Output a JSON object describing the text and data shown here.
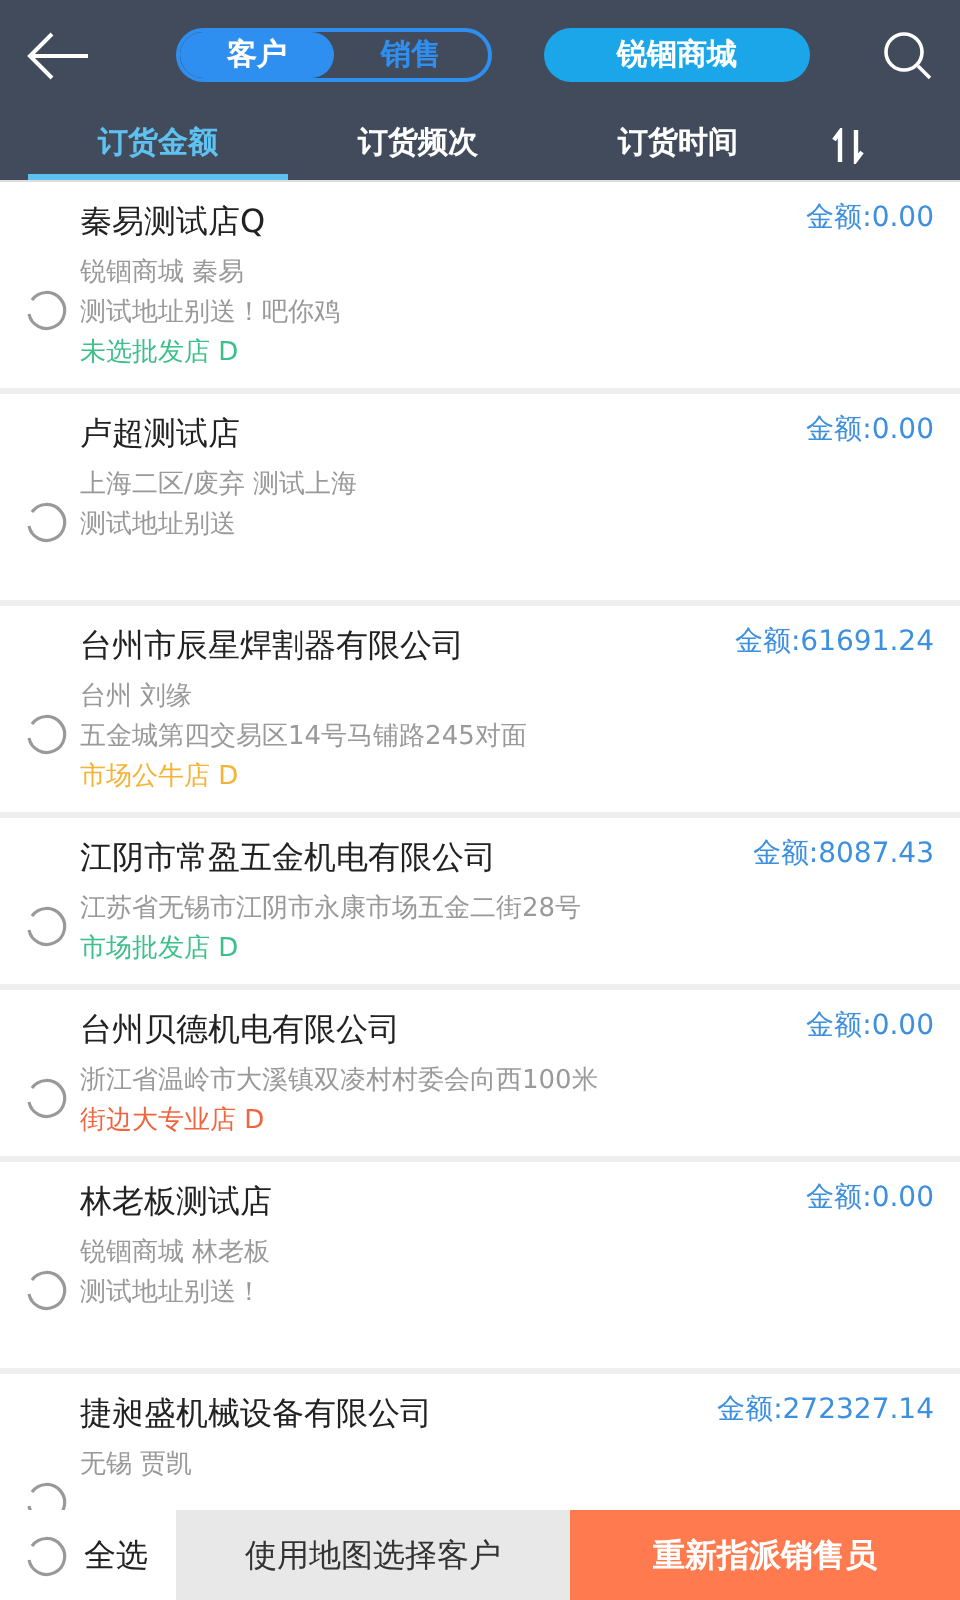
{
  "header": {
    "segments": [
      {
        "label": "客户",
        "selected": true
      },
      {
        "label": "销售",
        "selected": false
      }
    ],
    "store_button": "锐锢商城"
  },
  "sort_tabs": [
    {
      "label": "订货金额",
      "selected": true
    },
    {
      "label": "订货频次",
      "selected": false
    },
    {
      "label": "订货时间",
      "selected": false
    }
  ],
  "customers": [
    {
      "name": "秦易测试店Q",
      "amount": "金额:0.00",
      "lines": [
        "锐锢商城 秦易",
        "测试地址别送！吧你鸡"
      ],
      "tag": {
        "label": "未选批发店 D",
        "color": "#3dbf8a"
      },
      "checked": false
    },
    {
      "name": "卢超测试店",
      "amount": "金额:0.00",
      "lines": [
        "上海二区/废弃 测试上海",
        "测试地址别送"
      ],
      "checked": false
    },
    {
      "name": "台州市辰星焊割器有限公司",
      "amount": "金额:61691.24",
      "lines": [
        "台州 刘缘",
        "五金城第四交易区14号马铺路245对面"
      ],
      "tag": {
        "label": "市场公牛店 D",
        "color": "#f5b335"
      },
      "checked": false
    },
    {
      "name": "江阴市常盈五金机电有限公司",
      "amount": "金额:8087.43",
      "lines": [
        "江苏省无锡市江阴市永康市场五金二街28号"
      ],
      "tag": {
        "label": "市场批发店 D",
        "color": "#3dbf8a"
      },
      "checked": false
    },
    {
      "name": "台州贝德机电有限公司",
      "amount": "金额:0.00",
      "lines": [
        "浙江省温岭市大溪镇双凌村村委会向西100米"
      ],
      "tag": {
        "label": "街边大专业店 D",
        "color": "#f0653f"
      },
      "checked": false
    },
    {
      "name": "林老板测试店",
      "amount": "金额:0.00",
      "lines": [
        "锐锢商城 林老板",
        "测试地址别送！"
      ],
      "checked": false
    },
    {
      "name": "捷昶盛机械设备有限公司",
      "amount": "金额:272327.14",
      "lines": [
        "无锡 贾凯"
      ],
      "checked": false
    }
  ],
  "footer": {
    "select_all": {
      "label": "全选",
      "checked": false
    },
    "map_button": "使用地图选择客户",
    "reassign_button": "重新指派销售员"
  }
}
